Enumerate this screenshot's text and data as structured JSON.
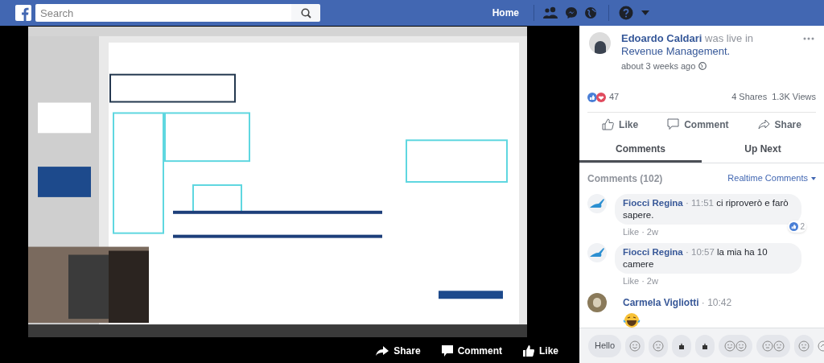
{
  "topbar": {
    "search": {
      "placeholder": "Search"
    },
    "nav": [
      "Home"
    ]
  },
  "post": {
    "author": "Edoardo Caldari",
    "action": "was live in",
    "group": "Revenue Management.",
    "time": "about 3 weeks ago"
  },
  "stats": {
    "reactions": "47",
    "shares": "4 Shares",
    "views": "1.3K Views"
  },
  "actions": [
    "Like",
    "Comment",
    "Share"
  ],
  "tabs": [
    {
      "label": "Comments",
      "selected": true
    },
    {
      "label": "Up Next",
      "selected": false
    }
  ],
  "comments_header": {
    "title": "Comments (102)",
    "sort": "Realtime Comments"
  },
  "comments": [
    {
      "kind": "text",
      "author": "Fiocci Regina",
      "time": "11:51",
      "text": "ci riproverò e farò sapere.",
      "likes": "2",
      "meta": [
        "Like",
        "2w"
      ]
    },
    {
      "kind": "text",
      "author": "Fiocci Regina",
      "time": "10:57",
      "text": "la mia ha 10 camere",
      "meta": [
        "Like",
        "2w"
      ]
    },
    {
      "kind": "emoji",
      "author": "Carmela Vigliotti",
      "time": "10:42"
    }
  ],
  "separator": "·",
  "quick_replies": [
    "Hello"
  ],
  "video_actions": [
    "Share",
    "Comment",
    "Like"
  ]
}
